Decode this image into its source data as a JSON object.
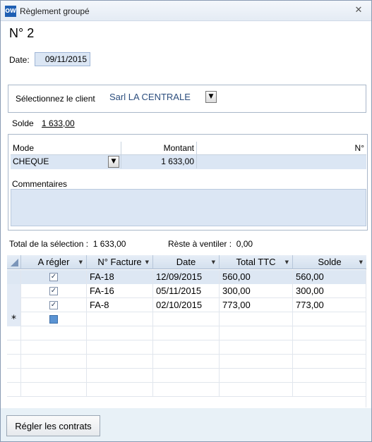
{
  "window": {
    "title": "Règlement groupé",
    "icon": "ow-app-icon"
  },
  "heading": "N° 2",
  "date": {
    "label": "Date:",
    "value": "09/11/2015"
  },
  "client": {
    "label": "Sélectionnez le client",
    "value": "Sarl LA CENTRALE"
  },
  "solde": {
    "label": "Solde",
    "value": "1 633,00"
  },
  "payment": {
    "headers": {
      "mode": "Mode",
      "montant": "Montant",
      "numero": "N°"
    },
    "row": {
      "mode": "CHEQUE",
      "montant": "1 633,00",
      "numero": ""
    },
    "comment_label": "Commentaires",
    "comment_value": ""
  },
  "totals": {
    "selection_label": "Total de la sélection :",
    "selection_value": "1 633,00",
    "reste_label": "Rèste à ventiler :",
    "reste_value": "0,00"
  },
  "grid": {
    "headers": [
      "A régler",
      "N° Facture",
      "Date",
      "Total TTC",
      "Solde"
    ],
    "rows": [
      {
        "checked": true,
        "facture": "FA-18",
        "date": "12/09/2015",
        "total": "560,00",
        "solde": "560,00"
      },
      {
        "checked": true,
        "facture": "FA-16",
        "date": "05/11/2015",
        "total": "300,00",
        "solde": "300,00"
      },
      {
        "checked": true,
        "facture": "FA-8",
        "date": "02/10/2015",
        "total": "773,00",
        "solde": "773,00"
      }
    ],
    "new_row_marker": "*"
  },
  "footer": {
    "button_label": "Régler les contrats"
  }
}
